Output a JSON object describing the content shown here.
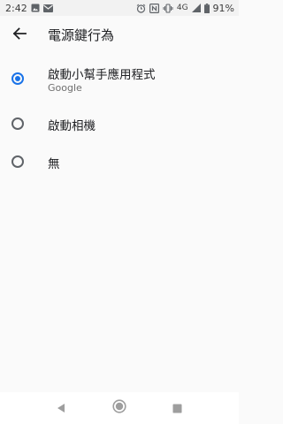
{
  "status_bar": {
    "time": "2:42",
    "network": "4G",
    "battery": "91%",
    "left_icons": [
      "image-icon",
      "mail-icon"
    ],
    "right_icons": [
      "alarm-icon",
      "nfc-icon",
      "vibrate-icon",
      "signal-icon",
      "battery-icon"
    ]
  },
  "app_bar": {
    "title": "電源鍵行為",
    "back_icon": "back-arrow-icon"
  },
  "options": [
    {
      "label": "啟動小幫手應用程式",
      "sublabel": "Google",
      "selected": true
    },
    {
      "label": "啟動相機",
      "selected": false
    },
    {
      "label": "無",
      "selected": false
    }
  ],
  "nav_bar": {
    "buttons": [
      "back-triangle-icon",
      "home-circle-icon",
      "recents-square-icon"
    ]
  },
  "colors": {
    "accent": "#1a73e8",
    "background": "#fafafa",
    "status_bar": "#f2f2f2"
  }
}
